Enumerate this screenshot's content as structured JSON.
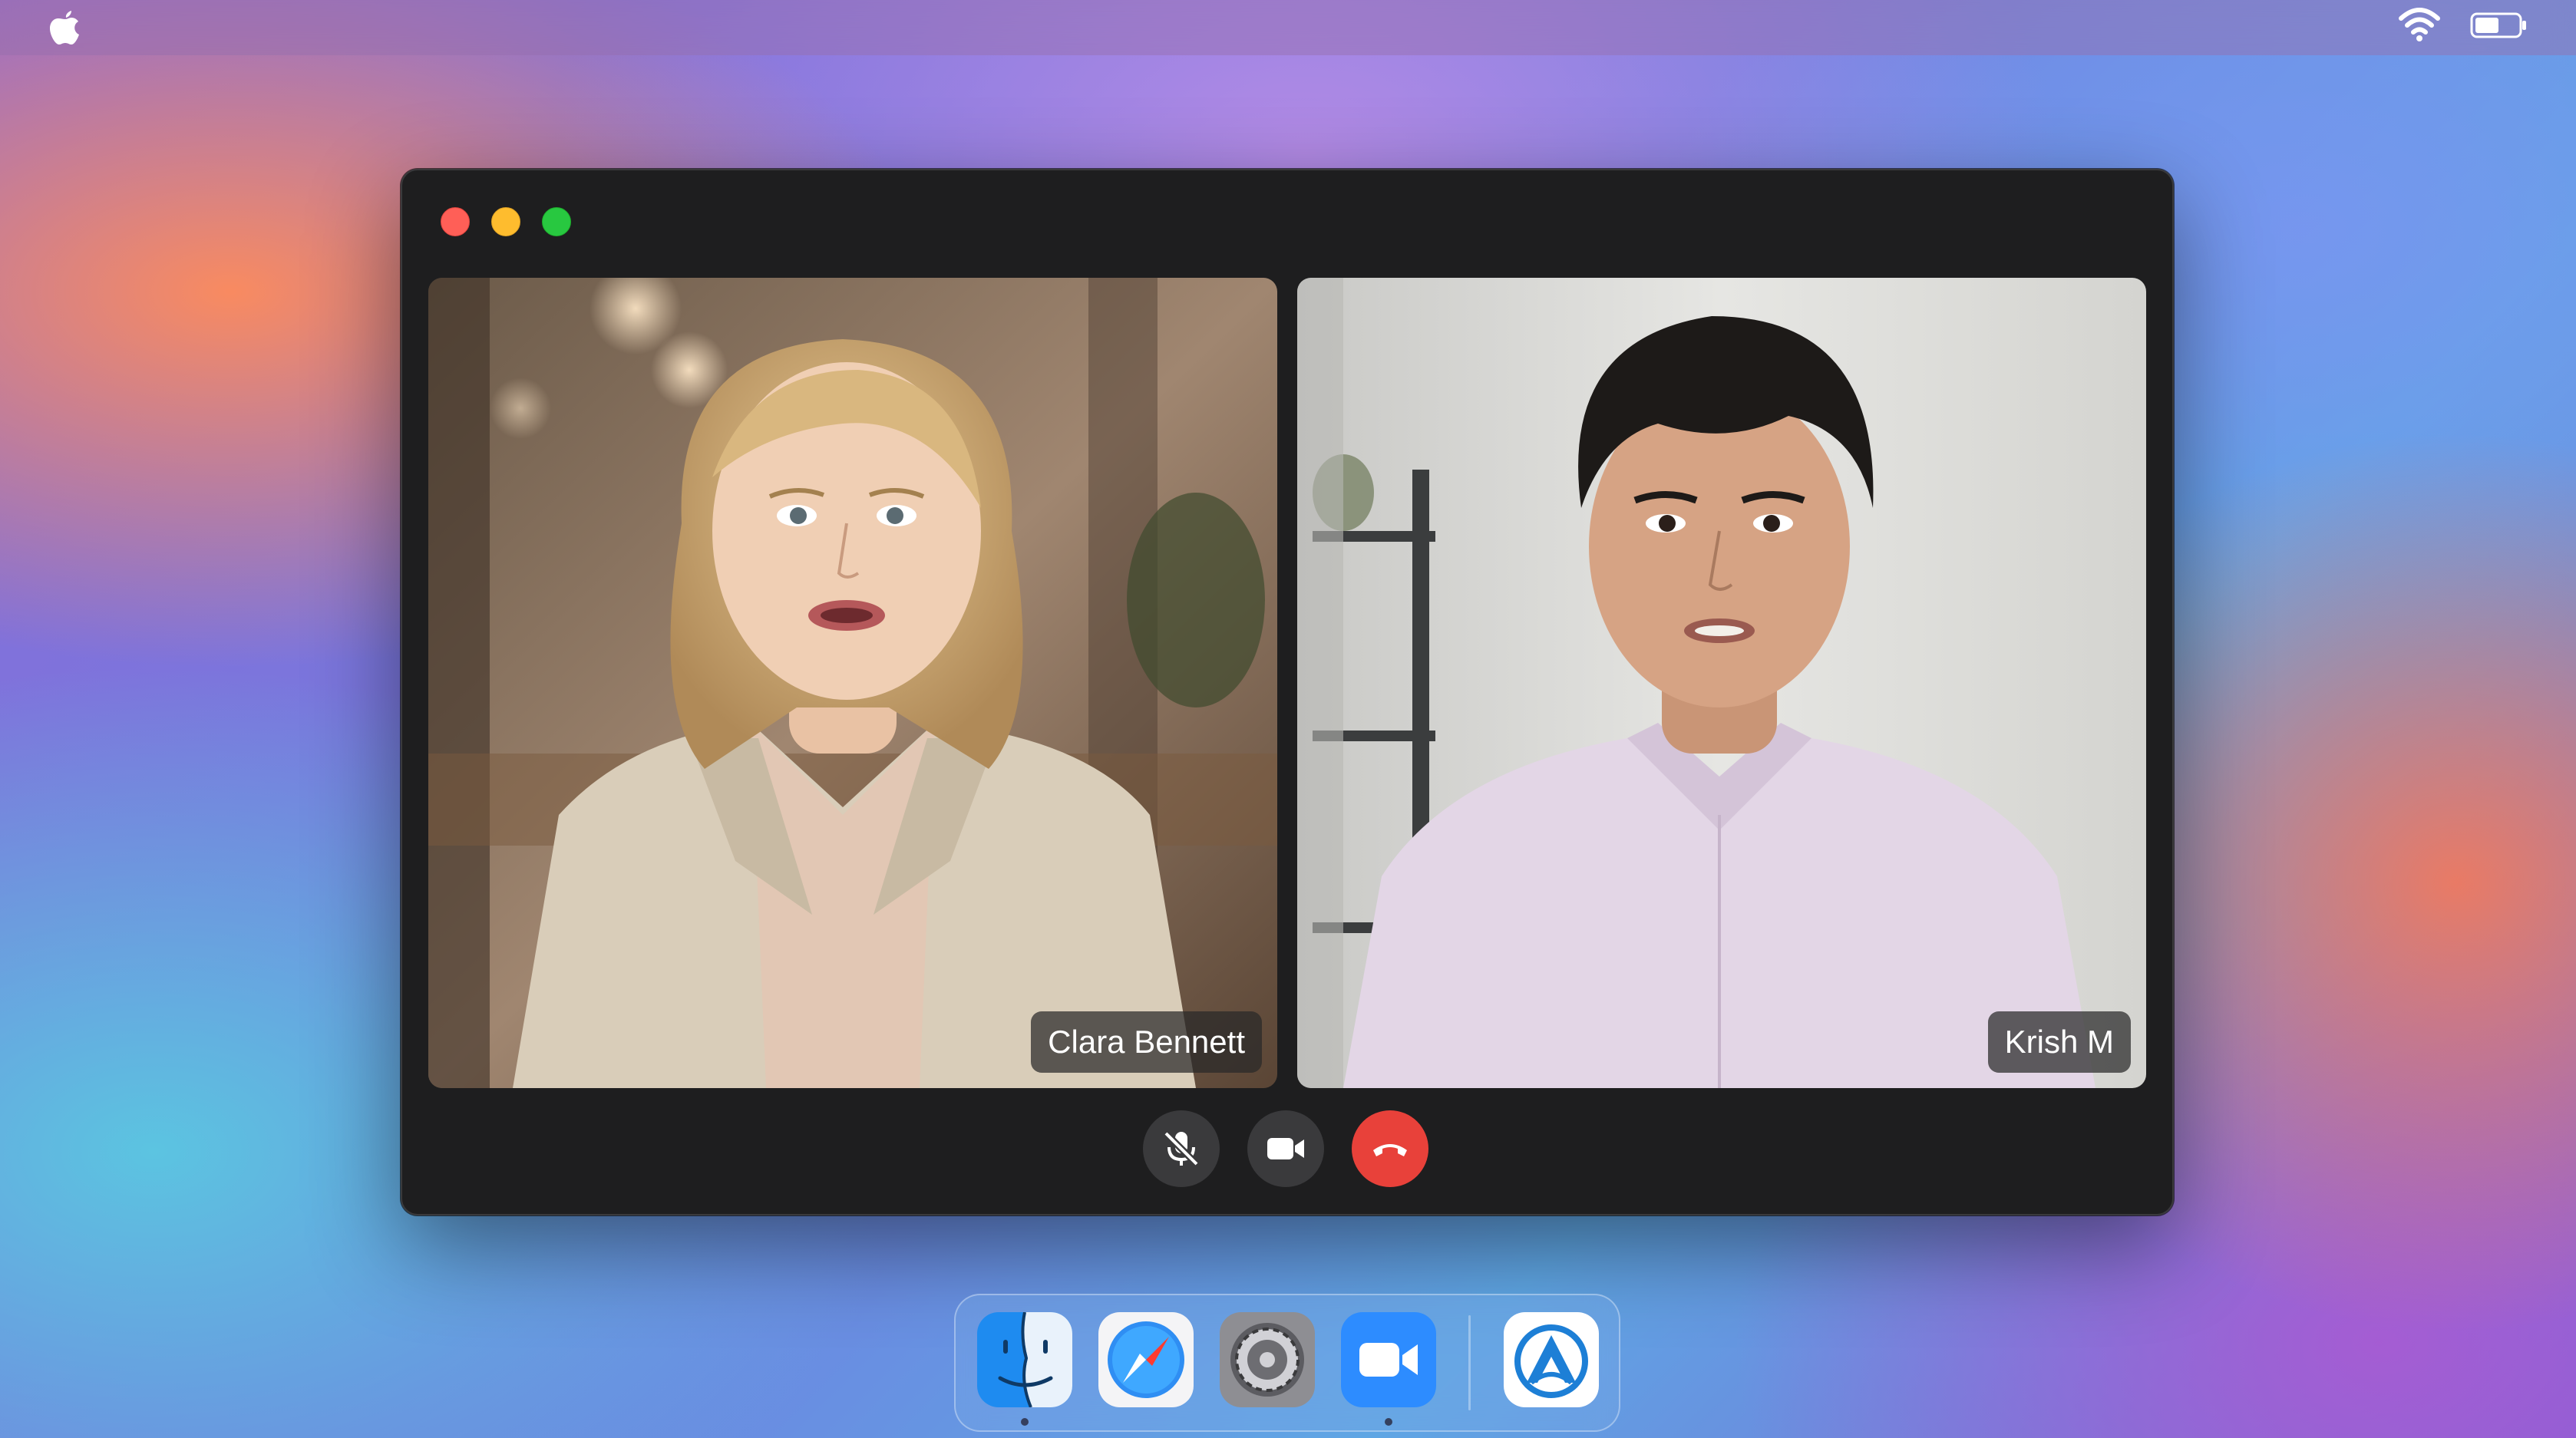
{
  "menubar": {
    "apple_icon": "apple-logo-icon",
    "wifi_icon": "wifi-icon",
    "battery_icon": "battery-icon"
  },
  "window": {
    "controls": [
      "close",
      "minimize",
      "zoom"
    ],
    "participants": [
      {
        "name": "Clara Bennett"
      },
      {
        "name": "Krish M"
      }
    ],
    "call_controls": {
      "mute_icon": "microphone-muted-icon",
      "video_icon": "video-camera-icon",
      "end_icon": "phone-hangup-icon"
    }
  },
  "dock": {
    "apps": [
      {
        "icon": "finder-icon",
        "running": true
      },
      {
        "icon": "safari-icon",
        "running": false
      },
      {
        "icon": "system-settings-icon",
        "running": false
      },
      {
        "icon": "zoom-icon",
        "running": true
      },
      {
        "icon": "custom-app-icon",
        "running": false
      }
    ]
  },
  "colors": {
    "end_call": "#e8413a",
    "close": "#ff5f57",
    "minimize": "#febc2e",
    "zoom": "#28c840"
  }
}
